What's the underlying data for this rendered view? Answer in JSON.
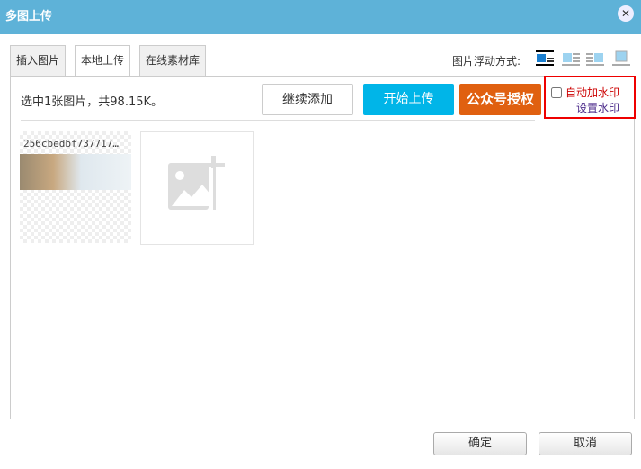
{
  "title": "多图上传",
  "tabs": [
    "插入图片",
    "本地上传",
    "在线素材库"
  ],
  "float_label": "图片浮动方式:",
  "info": "选中1张图片，共98.15K。",
  "buttons": {
    "continue": "继续添加",
    "start": "开始上传",
    "auth": "公众号授权"
  },
  "watermark": {
    "auto": "自动加水印",
    "settings": "设置水印"
  },
  "file_name": "256cbedbf737717…",
  "footer": {
    "ok": "确定",
    "cancel": "取消"
  },
  "colors": {
    "title": "#5eb2d8",
    "start": "#00b5e8",
    "auth": "#e06010"
  }
}
